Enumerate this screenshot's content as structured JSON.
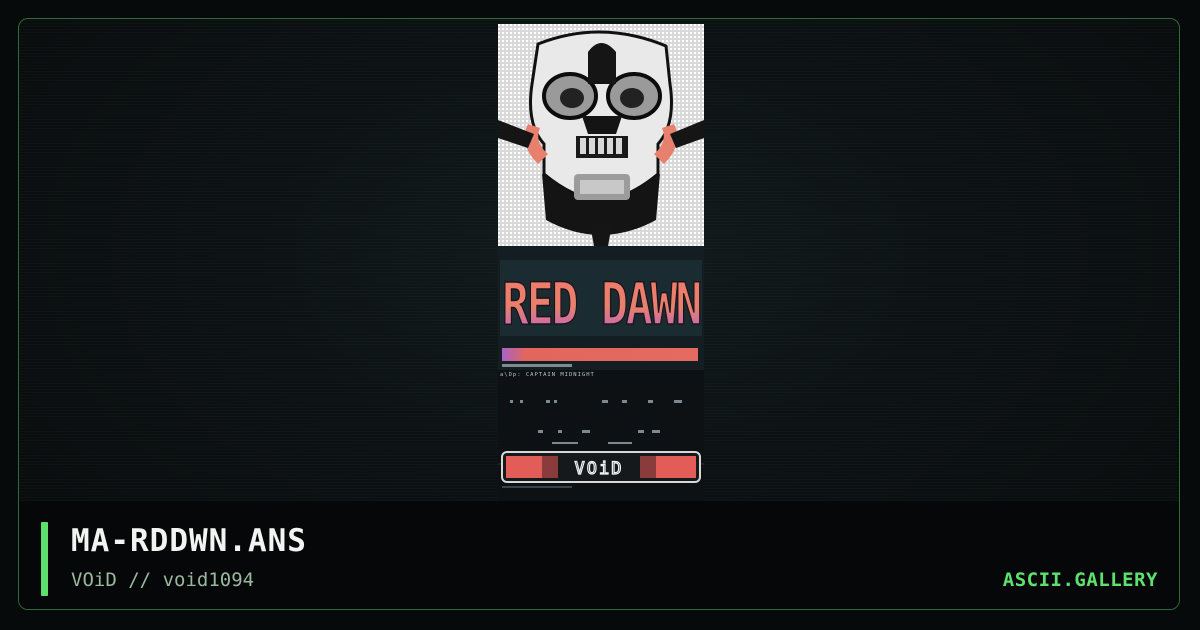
{
  "artwork": {
    "logo_text": "RED DAWN",
    "credit_line": "a\\Dp: CAPTAIN MIDNIGHT",
    "group_logo": "VOiD"
  },
  "meta": {
    "filename": "MA-RDDWN.ANS",
    "group": "VOiD",
    "separator": "//",
    "pack": "void1094"
  },
  "site": {
    "name": "ASCII.GALLERY"
  },
  "colors": {
    "accent": "#5ee06e",
    "frame": "#2f6a37",
    "background": "#080b0c",
    "footer": "#050708"
  }
}
